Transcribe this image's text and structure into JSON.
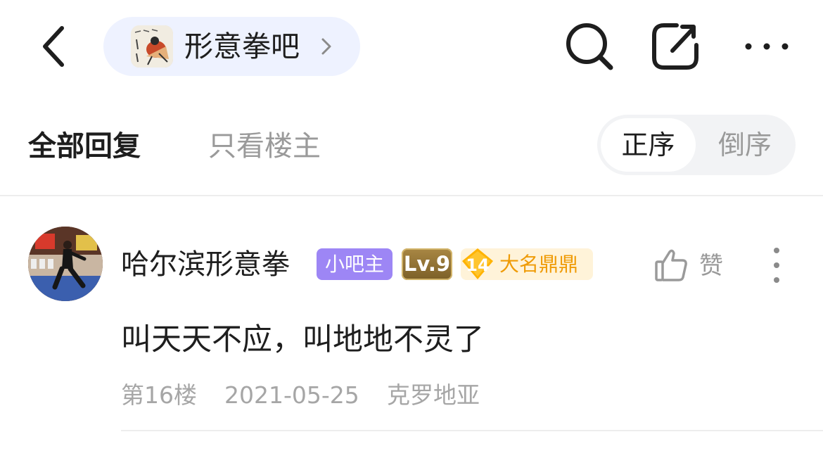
{
  "topbar": {
    "forum_name": "形意拳吧"
  },
  "icons": {
    "back": "chevron-left-icon",
    "search": "search-icon",
    "share": "share-icon",
    "more": "more-horizontal-icon",
    "like": "thumbs-up-icon",
    "post_more": "more-vertical-icon"
  },
  "tabs": {
    "all_replies": "全部回复",
    "op_only": "只看楼主",
    "active": "all_replies"
  },
  "sort": {
    "ascending": "正序",
    "descending": "倒序",
    "selected": "ascending"
  },
  "post": {
    "username": "哈尔滨形意拳",
    "admin_badge": "小吧主",
    "level_badge": "Lv.9",
    "title_badge_number": "14",
    "title_badge_label": "大名鼎鼎",
    "like_label": "赞",
    "content": "叫天天不应，叫地地不灵了",
    "floor": "第16楼",
    "date": "2021-05-25",
    "location": "克罗地亚"
  },
  "colors": {
    "accent_pill": "#eef2ff",
    "admin_badge": "#9d86f5",
    "title_badge_bg": "#fff3d9",
    "title_badge_text": "#ef9b06",
    "muted_text": "#9a9a9a"
  }
}
